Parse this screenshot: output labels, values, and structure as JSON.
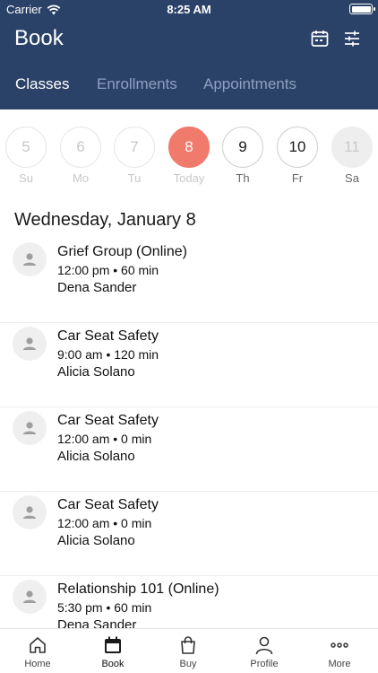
{
  "status": {
    "carrier": "Carrier",
    "time": "8:25 AM"
  },
  "header": {
    "title": "Book"
  },
  "tabs": [
    {
      "label": "Classes",
      "active": true
    },
    {
      "label": "Enrollments",
      "active": false
    },
    {
      "label": "Appointments",
      "active": false
    }
  ],
  "days": [
    {
      "num": "5",
      "label": "Su"
    },
    {
      "num": "6",
      "label": "Mo"
    },
    {
      "num": "7",
      "label": "Tu"
    },
    {
      "num": "8",
      "label": "Today"
    },
    {
      "num": "9",
      "label": "Th"
    },
    {
      "num": "10",
      "label": "Fr"
    },
    {
      "num": "11",
      "label": "Sa"
    }
  ],
  "date_heading": "Wednesday, January 8",
  "classes": [
    {
      "title": "Grief Group (Online)",
      "time": "12:00 pm • 60 min",
      "instructor": "Dena Sander"
    },
    {
      "title": "Car Seat Safety",
      "time": "9:00 am • 120 min",
      "instructor": "Alicia Solano"
    },
    {
      "title": "Car Seat Safety",
      "time": "12:00 am • 0 min",
      "instructor": "Alicia Solano"
    },
    {
      "title": "Car Seat Safety",
      "time": "12:00 am • 0 min",
      "instructor": "Alicia Solano"
    },
    {
      "title": "Relationship 101 (Online)",
      "time": "5:30 pm • 60 min",
      "instructor": "Dena Sander"
    }
  ],
  "bottom_nav": [
    {
      "label": "Home",
      "icon": "home-icon"
    },
    {
      "label": "Book",
      "icon": "calendar-icon"
    },
    {
      "label": "Buy",
      "icon": "shopping-bag-icon"
    },
    {
      "label": "Profile",
      "icon": "person-icon"
    },
    {
      "label": "More",
      "icon": "more-icon"
    }
  ],
  "colors": {
    "header_bg": "#2a4268",
    "today": "#f07a6c"
  }
}
